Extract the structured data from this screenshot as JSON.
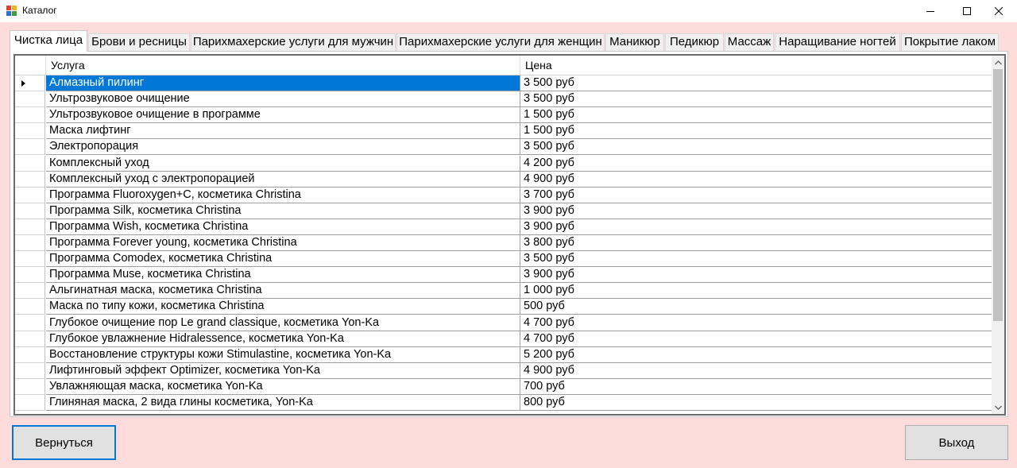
{
  "window": {
    "title": "Каталог"
  },
  "tabs": [
    {
      "label": "Чистка лица",
      "active": true
    },
    {
      "label": "Брови и ресницы"
    },
    {
      "label": "Парихмахерские услуги для мужчин"
    },
    {
      "label": "Парихмахерские услуги для женщин"
    },
    {
      "label": "Маникюр"
    },
    {
      "label": "Педикюр"
    },
    {
      "label": "Массаж"
    },
    {
      "label": "Наращивание ногтей"
    },
    {
      "label": "Покрытие лаком"
    }
  ],
  "grid": {
    "columns": [
      "Услуга",
      "Цена"
    ],
    "selected_row": 0,
    "rows": [
      [
        "Алмазный пилинг",
        "3 500 руб"
      ],
      [
        "Ультрозвуковое очищение",
        "3 500 руб"
      ],
      [
        "Ультрозвуковое очищение в программе",
        "1 500 руб"
      ],
      [
        "Маска лифтинг",
        "1 500 руб"
      ],
      [
        "Электропорация",
        "3 500 руб"
      ],
      [
        "Комплексный уход",
        "4 200 руб"
      ],
      [
        "Комплексный уход с электропорацией",
        "4 900 руб"
      ],
      [
        "Программа Fluoroxygen+C, косметика Christina",
        "3 700 руб"
      ],
      [
        "Программа Silk, косметика Christina",
        "3 900 руб"
      ],
      [
        "Программа Wish, косметика Christina",
        "3 900 руб"
      ],
      [
        "Программа Forever young, косметика Christina",
        "3 800 руб"
      ],
      [
        "Программа Comodex, косметика Christina",
        "3 500 руб"
      ],
      [
        "Программа Muse, косметика Christina",
        "3 900 руб"
      ],
      [
        "Альгинатная маска, косметика Christina",
        "1 000 руб"
      ],
      [
        "Маска по типу кожи, косметика Christina",
        "500 руб"
      ],
      [
        "Глубокое очищение пор Le grand classique, косметика Yon-Ka",
        "4 700 руб"
      ],
      [
        "Глубокое увлажнение Hidralessence, косметика Yon-Ka",
        "4 700 руб"
      ],
      [
        "Восстановление структуры кожи Stimulastine, косметика Yon-Ka",
        "5 200 руб"
      ],
      [
        "Лифтинговый эффект Optimizer, косметика Yon-Ka",
        "4 900 руб"
      ],
      [
        "Увлажняющая маска, косметика Yon-Ka",
        "700 руб"
      ],
      [
        "Глиняная маска, 2 вида глины косметика, Yon-Ka",
        "800 руб"
      ]
    ]
  },
  "buttons": {
    "back_label": "Вернуться",
    "exit_label": "Выход"
  },
  "colors": {
    "background": "#ffdcdc",
    "selection": "#0078d7"
  }
}
